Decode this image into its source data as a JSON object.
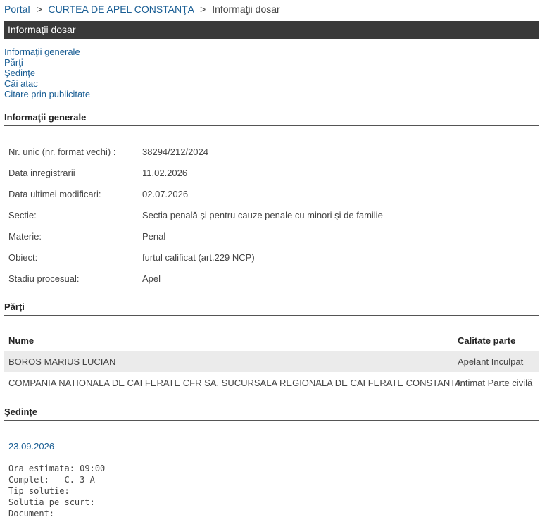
{
  "breadcrumb": {
    "portal": "Portal",
    "sep1": ">",
    "court": "CURTEA DE APEL CONSTANŢA",
    "sep2": ">",
    "current": "Informaţii dosar"
  },
  "title": "Informaţii dosar",
  "toc": [
    "Informaţii generale",
    "Părţi",
    "Şedinţe",
    "Căi atac",
    "Citare prin publicitate"
  ],
  "general": {
    "heading": "Informaţii generale",
    "rows": [
      {
        "label": "Nr. unic (nr. format vechi) :",
        "value": "38294/212/2024"
      },
      {
        "label": "Data inregistrarii",
        "value": "11.02.2026"
      },
      {
        "label": "Data ultimei modificari:",
        "value": "02.07.2026"
      },
      {
        "label": "Sectie:",
        "value": "Sectia penală şi pentru cauze penale cu minori şi de familie"
      },
      {
        "label": "Materie:",
        "value": "Penal"
      },
      {
        "label": "Obiect:",
        "value": "furtul calificat (art.229 NCP)"
      },
      {
        "label": "Stadiu procesual:",
        "value": "Apel"
      }
    ]
  },
  "parti": {
    "heading": "Părţi",
    "col_name": "Nume",
    "col_role": "Calitate parte",
    "rows": [
      {
        "name": "BOROS MARIUS LUCIAN",
        "role": "Apelant Inculpat"
      },
      {
        "name": "COMPANIA NATIONALA DE CAI FERATE CFR SA, SUCURSALA REGIONALA DE CAI FERATE CONSTANTA",
        "role": "Intimat Parte civilă"
      }
    ]
  },
  "sedinte": {
    "heading": "Şedinţe",
    "date": "23.09.2026",
    "lines": [
      "Ora estimata: 09:00",
      "Complet: - C. 3 A",
      "Tip solutie:",
      "Solutia pe scurt:",
      "Document:"
    ]
  }
}
